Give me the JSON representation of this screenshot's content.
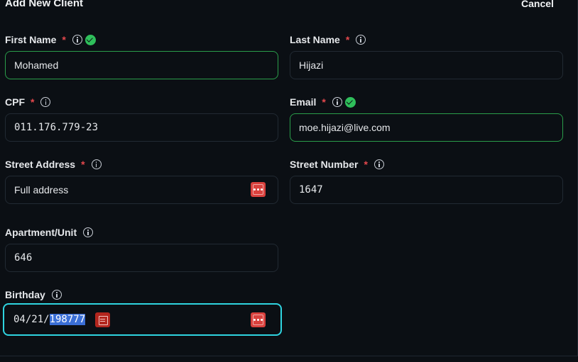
{
  "header": {
    "title": "Add New Client",
    "cancel_label": "Cancel"
  },
  "fields": {
    "first_name": {
      "label": "First Name",
      "required_mark": "*",
      "value": "Mohamed",
      "valid": true
    },
    "last_name": {
      "label": "Last Name",
      "required_mark": "*",
      "value": "Hijazi"
    },
    "cpf": {
      "label": "CPF",
      "required_mark": "*",
      "value": "011.176.779-23"
    },
    "email": {
      "label": "Email",
      "required_mark": "*",
      "value": "moe.hijazi@live.com",
      "valid": true
    },
    "street_address": {
      "label": "Street Address",
      "required_mark": "*",
      "placeholder": "Full address"
    },
    "street_number": {
      "label": "Street Number",
      "required_mark": "*",
      "value": "1647"
    },
    "apartment": {
      "label": "Apartment/Unit",
      "value": "646"
    },
    "birthday": {
      "label": "Birthday",
      "value_prefix": "04/21/",
      "value_selected": "198777"
    }
  },
  "icons": {
    "info": "info-icon",
    "valid": "check-circle-icon",
    "more": "dots-icon",
    "calendar": "calendar-icon"
  },
  "colors": {
    "background": "#0b0f14",
    "required": "#e5484d",
    "valid": "#2fbf5b",
    "focus": "#2fd4e0",
    "action_button": "#d9413d"
  }
}
